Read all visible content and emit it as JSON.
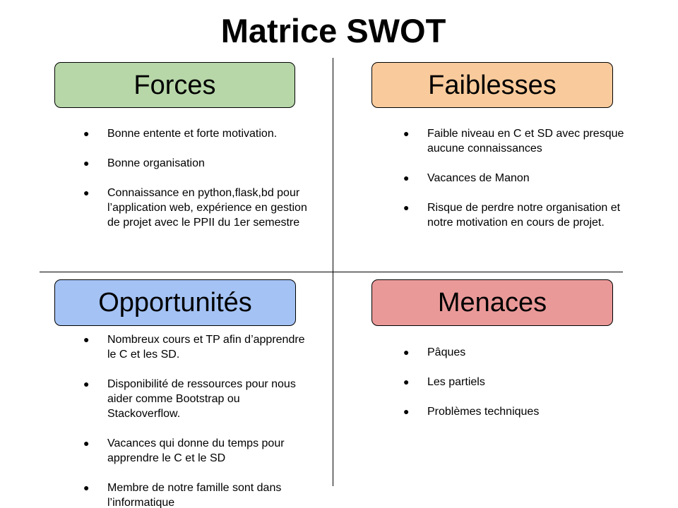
{
  "title": "Matrice SWOT",
  "colors": {
    "forces": "#b7d7a8",
    "faiblesses": "#f9cb9c",
    "opportunites": "#a4c2f4",
    "menaces": "#ea9999"
  },
  "quadrants": {
    "forces": {
      "heading": "Forces",
      "items": [
        "Bonne entente et forte motivation.",
        "Bonne organisation",
        "Connaissance en python,flask,bd pour l’application web, expérience en gestion de projet avec le PPII du 1er semestre"
      ]
    },
    "faiblesses": {
      "heading": "Faiblesses",
      "items": [
        "Faible niveau en C et SD avec presque aucune connaissances",
        "Vacances de Manon",
        "Risque de perdre notre organisation et notre motivation en cours de projet."
      ]
    },
    "opportunites": {
      "heading": "Opportunités",
      "items": [
        "Nombreux cours et  TP afin d’apprendre le C et les SD.",
        "Disponibilité de ressources pour nous aider comme Bootstrap ou Stackoverflow.",
        "Vacances qui donne du temps pour apprendre le C et le SD",
        "Membre de notre famille sont dans l’informatique"
      ]
    },
    "menaces": {
      "heading": "Menaces",
      "items": [
        "Pâques",
        "Les partiels",
        "Problèmes techniques"
      ]
    }
  }
}
